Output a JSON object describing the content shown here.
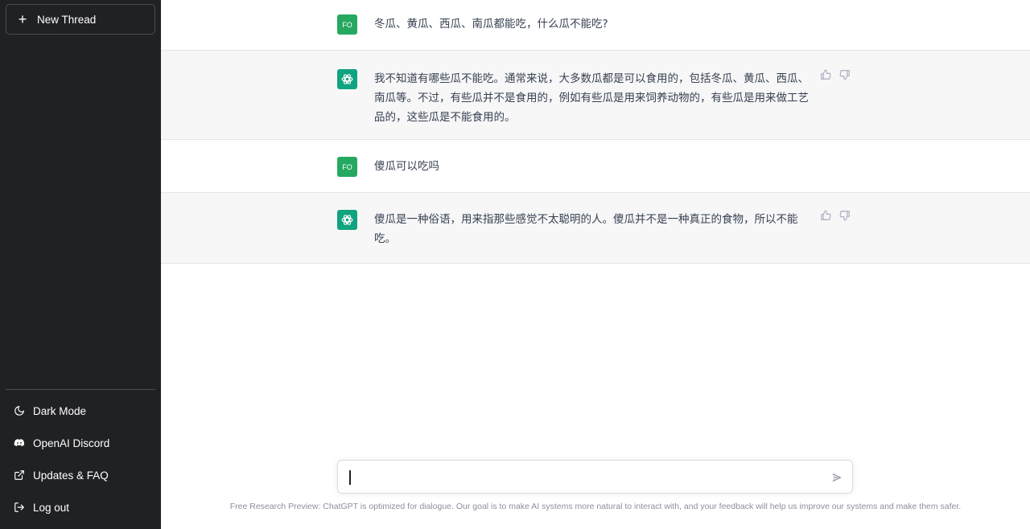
{
  "sidebar": {
    "new_thread_label": "New Thread",
    "items": [
      {
        "label": "Dark Mode",
        "icon": "moon-icon"
      },
      {
        "label": "OpenAI Discord",
        "icon": "discord-icon"
      },
      {
        "label": "Updates & FAQ",
        "icon": "external-link-icon"
      },
      {
        "label": "Log out",
        "icon": "logout-icon"
      }
    ]
  },
  "conversation": [
    {
      "role": "user",
      "avatar": "FO",
      "text": "冬瓜、黄瓜、西瓜、南瓜都能吃，什么瓜不能吃?"
    },
    {
      "role": "assistant",
      "text": "我不知道有哪些瓜不能吃。通常来说，大多数瓜都是可以食用的，包括冬瓜、黄瓜、西瓜、南瓜等。不过，有些瓜并不是食用的，例如有些瓜是用来饲养动物的，有些瓜是用来做工艺品的，这些瓜是不能食用的。"
    },
    {
      "role": "user",
      "avatar": "FO",
      "text": "傻瓜可以吃吗"
    },
    {
      "role": "assistant",
      "text": "傻瓜是一种俗语，用来指那些感觉不太聪明的人。傻瓜并不是一种真正的食物，所以不能吃。"
    }
  ],
  "composer": {
    "value": ""
  },
  "footer_note": "Free Research Preview: ChatGPT is optimized for dialogue. Our goal is to make AI systems more natural to interact with, and your feedback will help us improve our systems and make them safer.",
  "colors": {
    "sidebar_bg": "#202123",
    "accent": "#10a37f",
    "user_avatar": "#25a961",
    "assistant_row_bg": "#f7f7f8"
  }
}
